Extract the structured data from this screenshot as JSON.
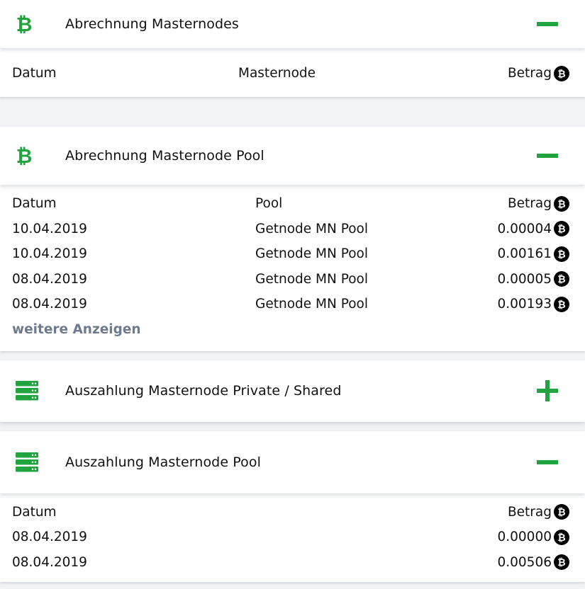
{
  "sections": {
    "s1": {
      "title": "Abrechnung Masternodes",
      "toggle": "minus",
      "columns": [
        "Datum",
        "Masternode",
        "Betrag"
      ]
    },
    "s2": {
      "title": "Abrechnung Masternode Pool",
      "toggle": "minus",
      "columns": [
        "Datum",
        "Pool",
        "Betrag"
      ],
      "rows": [
        {
          "date": "10.04.2019",
          "pool": "Getnode MN Pool",
          "amount": "0.00004"
        },
        {
          "date": "10.04.2019",
          "pool": "Getnode MN Pool",
          "amount": "0.00161"
        },
        {
          "date": "08.04.2019",
          "pool": "Getnode MN Pool",
          "amount": "0.00005"
        },
        {
          "date": "08.04.2019",
          "pool": "Getnode MN Pool",
          "amount": "0.00193"
        }
      ],
      "more_label": "weitere Anzeigen"
    },
    "s3": {
      "title": "Auszahlung Masternode Private / Shared",
      "toggle": "plus"
    },
    "s4": {
      "title": "Auszahlung Masternode Pool",
      "toggle": "minus",
      "columns": [
        "Datum",
        "Betrag"
      ],
      "rows": [
        {
          "date": "08.04.2019",
          "amount": "0.00000"
        },
        {
          "date": "08.04.2019",
          "amount": "0.00506"
        }
      ]
    }
  },
  "icons": {
    "section_bitcoin": "bitcoin-icon",
    "section_server": "server-icon",
    "currency": "bitcoin-coin-icon",
    "collapse": "minus-icon",
    "expand": "plus-icon"
  },
  "colors": {
    "accent_green": "#21a43f",
    "link_gray": "#6d7b91",
    "background": "#f2f3f6"
  }
}
